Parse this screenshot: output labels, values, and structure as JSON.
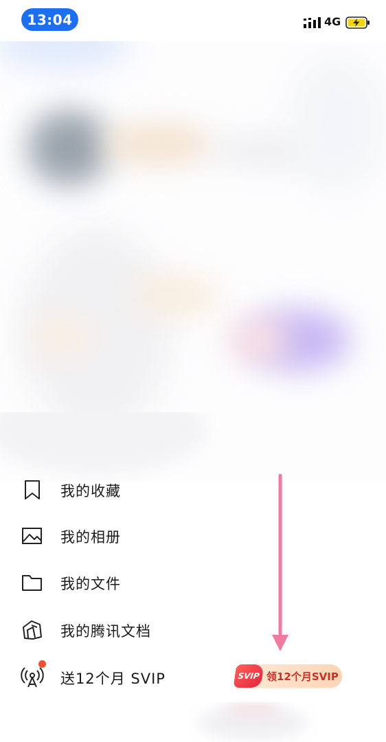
{
  "status_bar": {
    "time": "13:04",
    "network": "4G",
    "icons": {
      "signal": "signal-bars-icon",
      "battery": "battery-charging-icon"
    },
    "colors": {
      "time_pill": "#1e6ff0",
      "battery_fill": "#f5d30f"
    }
  },
  "menu": {
    "items": [
      {
        "label": "我的收藏",
        "icon": "bookmark-icon"
      },
      {
        "label": "我的相册",
        "icon": "photo-album-icon"
      },
      {
        "label": "我的文件",
        "icon": "folder-icon"
      },
      {
        "label": "我的腾讯文档",
        "icon": "tencent-docs-icon"
      },
      {
        "label": "送12个月 SVIP",
        "icon": "broadcast-icon",
        "has_red_dot": true
      }
    ]
  },
  "promo": {
    "tag": "SVIP",
    "text": "领12个月SVIP",
    "colors": {
      "tag": "#e2263c",
      "text": "#c2332b",
      "background": "#fbd5b4"
    }
  },
  "annotation": {
    "arrow_color": "#f07aa0",
    "icon": "down-arrow-icon"
  }
}
